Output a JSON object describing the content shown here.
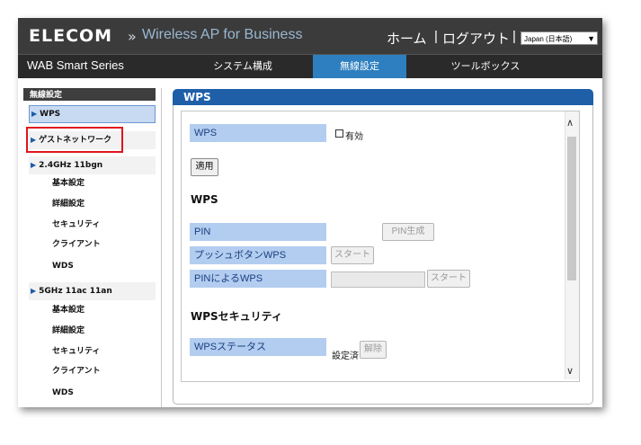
{
  "header": {
    "logo": "ELECOM",
    "separator": "»",
    "product": "Wireless AP for Business",
    "home": "ホーム",
    "pipe": "|",
    "logout": "ログアウト",
    "language": "Japan (日本語)"
  },
  "nav": {
    "series": "WAB Smart Series",
    "tabs": [
      "システム構成",
      "無線設定",
      "ツールボックス"
    ],
    "active_tab": "無線設定",
    "active_color": "#2e7fbf"
  },
  "sidebar": {
    "header": "無線設定",
    "items": [
      {
        "label": "WPS",
        "selected": true
      },
      {
        "label": "ゲストネットワーク"
      },
      {
        "label": "2.4GHz 11bgn"
      },
      {
        "label": "基本設定"
      },
      {
        "label": "詳細設定"
      },
      {
        "label": "セキュリティ"
      },
      {
        "label": "クライアント"
      },
      {
        "label": "WDS"
      },
      {
        "label": "5GHz 11ac 11an"
      },
      {
        "label": "基本設定"
      },
      {
        "label": "詳細設定"
      },
      {
        "label": "セキュリティ"
      },
      {
        "label": "クライアント"
      },
      {
        "label": "WDS"
      }
    ],
    "highlight_color": "#e0151c"
  },
  "main": {
    "title": "WPS",
    "wps_label": "WPS",
    "wps_enable_label": "有効",
    "apply_button": "適用",
    "wps_section": "WPS",
    "pin_label": "PIN",
    "pin_generate_button": "PIN生成",
    "push_button_label": "プッシュボタンWPS",
    "start_button": "スタート",
    "pin_wps_label": "PINによるWPS",
    "security_section": "WPSセキュリティ",
    "status_label": "WPSステータス",
    "status_value": "設定済",
    "release_button": "解除"
  },
  "icons": {
    "triangle": "▶",
    "scroll_up": "∧",
    "scroll_down": "∨",
    "dropdown": "▼"
  }
}
